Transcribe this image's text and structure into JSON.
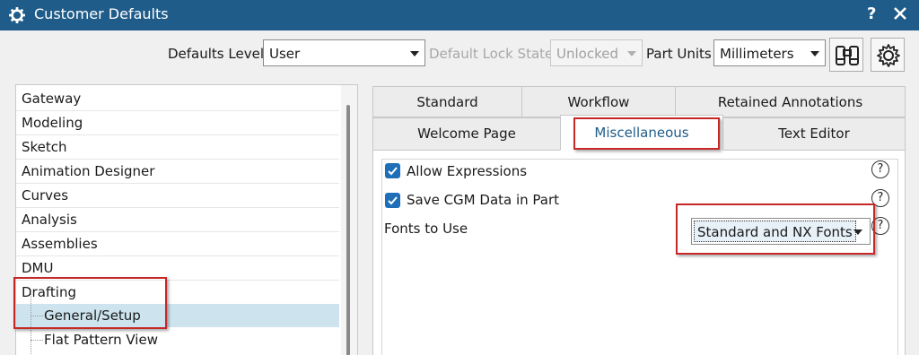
{
  "window": {
    "title": "Customer Defaults",
    "help_label": "?",
    "title_bar_color": "#1f5c8a",
    "icons": [
      "gear-icon",
      "close-icon"
    ]
  },
  "toolbar": {
    "defaults_level_label": "Defaults Level",
    "defaults_level_value": "User",
    "default_lock_state_label": "Default Lock State",
    "default_lock_state_value": "Unlocked",
    "part_units_label": "Part Units",
    "part_units_value": "Millimeters",
    "icons": [
      "binoculars-icon",
      "settings-gear-icon"
    ]
  },
  "tree": {
    "items": [
      {
        "label": "Gateway"
      },
      {
        "label": "Modeling"
      },
      {
        "label": "Sketch"
      },
      {
        "label": "Animation Designer"
      },
      {
        "label": "Curves"
      },
      {
        "label": "Analysis"
      },
      {
        "label": "Assemblies"
      },
      {
        "label": "DMU"
      },
      {
        "label": "Drafting"
      },
      {
        "label": "General/Setup"
      },
      {
        "label": "Flat Pattern View"
      }
    ],
    "selected": "General/Setup"
  },
  "tabs": {
    "row1": [
      "Standard",
      "Workflow",
      "Retained Annotations"
    ],
    "row2": [
      "Welcome Page",
      "Miscellaneous",
      "Text Editor"
    ],
    "active": "Miscellaneous"
  },
  "options": {
    "allow_expressions_label": "Allow Expressions",
    "allow_expressions_checked": true,
    "save_cgm_label": "Save CGM Data in Part",
    "save_cgm_checked": true,
    "fonts_to_use_label": "Fonts to Use",
    "fonts_to_use_value": "Standard and NX Fonts",
    "help_label": "?"
  },
  "highlight_color": "#c62828"
}
